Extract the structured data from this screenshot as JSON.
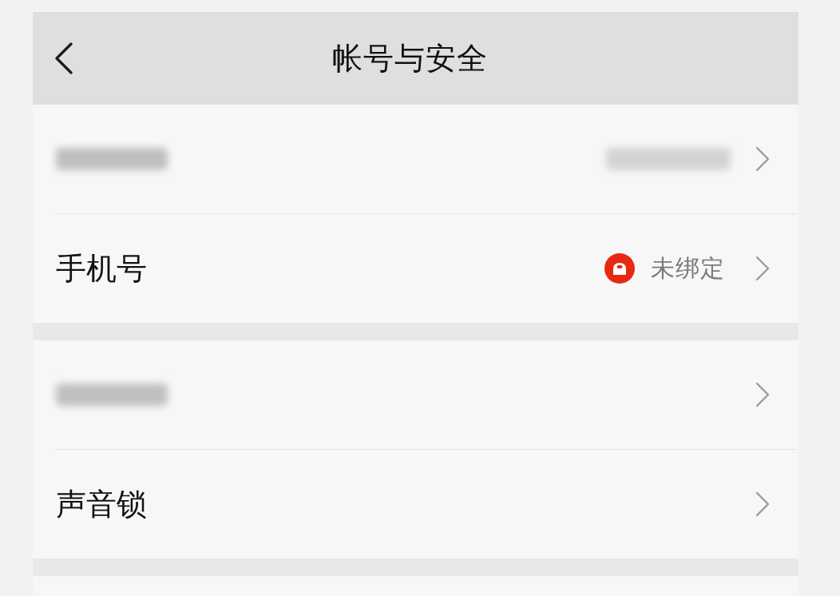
{
  "nav_bar": {
    "title": "帐号与安全"
  },
  "sections": [
    {
      "rows": [
        {
          "label_blurred": true,
          "value_blurred": true,
          "warning": false
        },
        {
          "label": "手机号",
          "label_blurred": false,
          "value": "未绑定",
          "value_blurred": false,
          "warning": true
        }
      ]
    },
    {
      "rows": [
        {
          "label_blurred": true,
          "value_blurred": false,
          "warning": false
        },
        {
          "label": "声音锁",
          "label_blurred": false,
          "value_blurred": false,
          "warning": false
        }
      ]
    }
  ]
}
